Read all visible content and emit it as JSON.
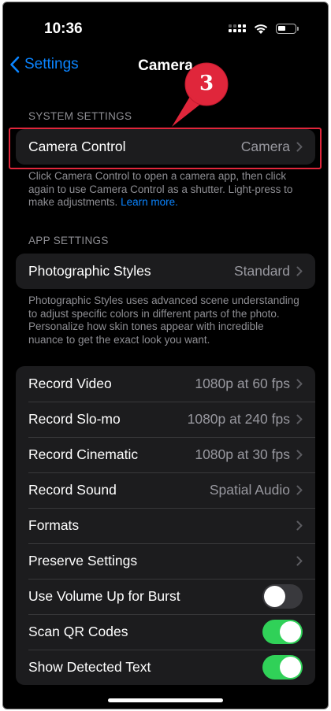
{
  "status_bar": {
    "time": "10:36"
  },
  "nav": {
    "back_label": "Settings",
    "title": "Camera"
  },
  "annotation": {
    "number": "3",
    "color": "#e0263b"
  },
  "system_settings": {
    "header": "SYSTEM SETTINGS",
    "rows": [
      {
        "label": "Camera Control",
        "value": "Camera"
      }
    ],
    "footer_text": "Click Camera Control to open a camera app, then click again to use Camera Control as a shutter. Light-press to make adjustments.",
    "footer_link": "Learn more."
  },
  "app_settings": {
    "header": "APP SETTINGS",
    "rows": [
      {
        "label": "Photographic Styles",
        "value": "Standard"
      }
    ],
    "footer_text": "Photographic Styles uses advanced scene understanding to adjust specific colors in different parts of the photo. Personalize how skin tones appear with incredible nuance to get the exact look you want."
  },
  "record_settings": {
    "rows": [
      {
        "label": "Record Video",
        "value": "1080p at 60 fps"
      },
      {
        "label": "Record Slo-mo",
        "value": "1080p at 240 fps"
      },
      {
        "label": "Record Cinematic",
        "value": "1080p at 30 fps"
      },
      {
        "label": "Record Sound",
        "value": "Spatial Audio"
      },
      {
        "label": "Formats",
        "value": ""
      },
      {
        "label": "Preserve Settings",
        "value": ""
      }
    ],
    "toggles": [
      {
        "label": "Use Volume Up for Burst",
        "on": false
      },
      {
        "label": "Scan QR Codes",
        "on": true
      },
      {
        "label": "Show Detected Text",
        "on": true
      }
    ]
  },
  "colors": {
    "accent": "#0a84ff",
    "toggle_on": "#30d158",
    "cell_bg": "#1c1c1e"
  }
}
